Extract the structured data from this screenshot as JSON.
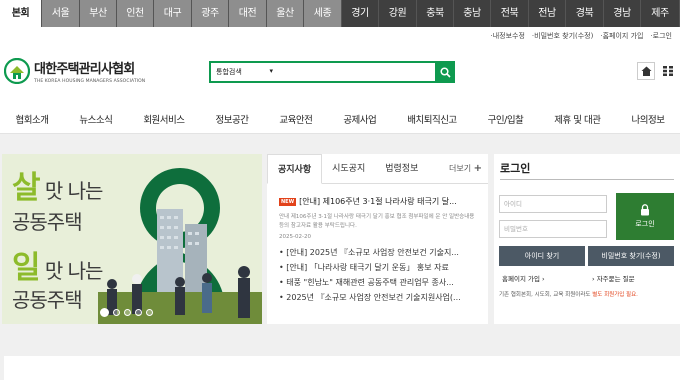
{
  "regions": [
    {
      "label": "본회",
      "style": "active",
      "w": 42
    },
    {
      "label": "서울",
      "style": "light",
      "w": 38
    },
    {
      "label": "부산",
      "style": "light",
      "w": 37
    },
    {
      "label": "인천",
      "style": "light",
      "w": 37
    },
    {
      "label": "대구",
      "style": "light",
      "w": 38
    },
    {
      "label": "광주",
      "style": "light",
      "w": 37
    },
    {
      "label": "대전",
      "style": "light",
      "w": 38
    },
    {
      "label": "울산",
      "style": "light",
      "w": 37
    },
    {
      "label": "세종",
      "style": "light",
      "w": 38
    },
    {
      "label": "경기",
      "style": "dark",
      "w": 37
    },
    {
      "label": "강원",
      "style": "dark",
      "w": 38
    },
    {
      "label": "충북",
      "style": "dark",
      "w": 37
    },
    {
      "label": "충남",
      "style": "dark",
      "w": 37
    },
    {
      "label": "전북",
      "style": "dark",
      "w": 38
    },
    {
      "label": "전남",
      "style": "dark",
      "w": 37
    },
    {
      "label": "경북",
      "style": "dark",
      "w": 38
    },
    {
      "label": "경남",
      "style": "dark",
      "w": 37
    },
    {
      "label": "제주",
      "style": "dark",
      "w": 39
    }
  ],
  "util": [
    "·내정보수정",
    "·비밀번호 찾기(수정)",
    "·홈페이지 가입",
    "·로그인"
  ],
  "logo": {
    "ko": "대한주택관리사협회",
    "en": "THE KOREA HOUSING MANAGERS ASSOCIATION"
  },
  "search": {
    "scope": "통합검색",
    "placeholder": ""
  },
  "gnb": [
    "협회소개",
    "뉴스소식",
    "회원서비스",
    "정보공간",
    "교육안전",
    "공제사업",
    "배치퇴직신고",
    "구인/입찰",
    "제휴 및 대관",
    "나의정보"
  ],
  "banner": {
    "l1a": "살",
    "l1b": " 맛 나는",
    "l2": "공동주택",
    "l3a": "일",
    "l3b": " 맛 나는",
    "l4": "공동주택",
    "slides": 5,
    "active_slide": 1
  },
  "notice": {
    "tabs": [
      "공지사항",
      "시도공지",
      "법령정보"
    ],
    "more": "더보기",
    "featured": {
      "badge": "NEW",
      "title": "[안내] 제106주년 3·1절 나라사랑 태극기 달...",
      "desc": "안내 제106주년 3·1절 나라사랑 태극기 달기 홍보 협조 첨부파일에 운 안 일반승내용 등의 참고자료 활용 부탁드립니다.",
      "date": "2025-02-20"
    },
    "items": [
      "• [안내] 2025년 『소규모 사업장 안전보건 기술지...",
      "• [안내] 「나라사랑 태극기 달기 운동」 홍보 자료",
      "• 태풍 \"힌남노\" 재해관련 공동주택 관리업무 종사...",
      "• 2025년 『소규모 사업장 안전보건 기술지원사업(..."
    ]
  },
  "login": {
    "title": "로그인",
    "id_placeholder": "아이디",
    "pw_placeholder": "비밀번호",
    "login_btn": "로그인",
    "find_id": "아이디 찾기",
    "find_pw": "비밀번호 찾기(수정)",
    "join": "홈페이지 가입",
    "faq": "자주묻는 질문",
    "note_a": "기존 협회본회, 시도회, 교육 회원이라도 ",
    "note_b": "별도 회원가입 필요."
  },
  "colors": {
    "brand_green": "#0e9a4f",
    "region_dark": "#3f3f3f",
    "region_light": "#8e8e8e",
    "accent_red": "#e2421a",
    "lime": "#8dbb2b"
  }
}
